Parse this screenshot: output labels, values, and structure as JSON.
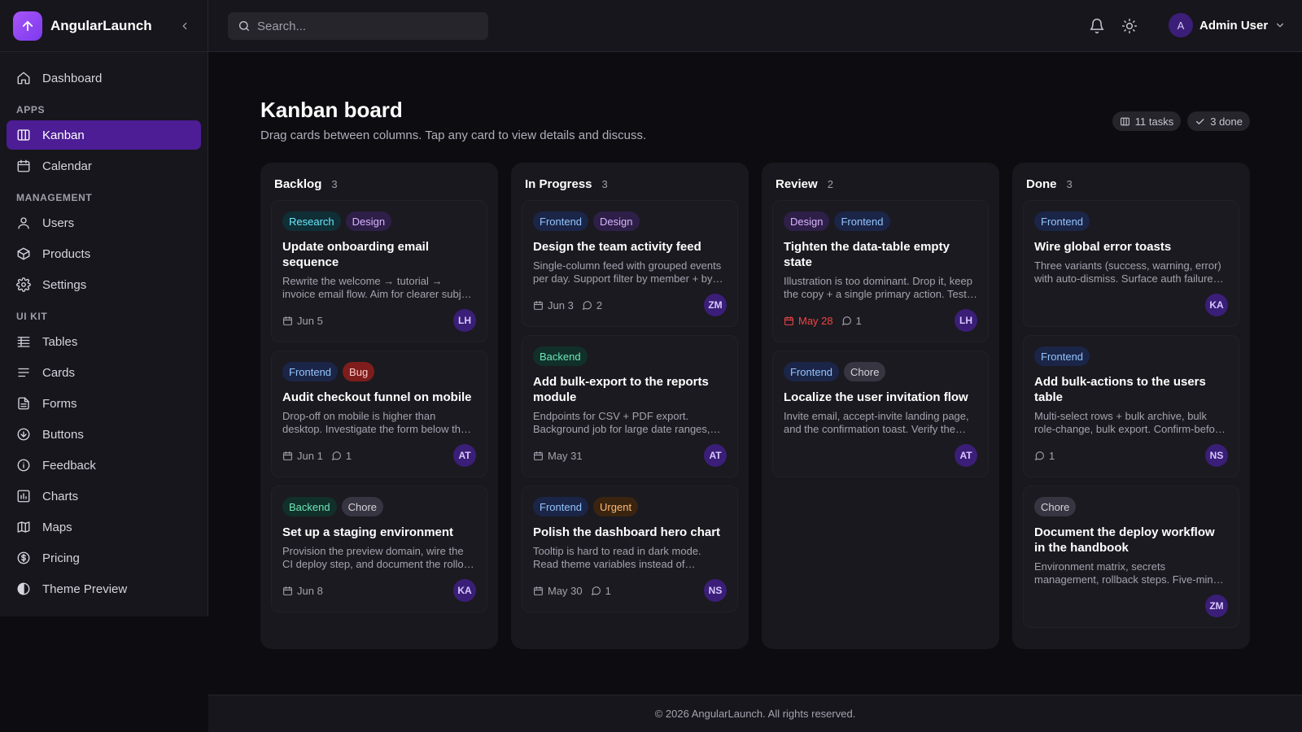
{
  "brand": {
    "name": "AngularLaunch"
  },
  "sidebar": {
    "top_items": [
      {
        "label": "Dashboard",
        "icon": "home-icon"
      }
    ],
    "sections": [
      {
        "title": "APPS",
        "items": [
          {
            "label": "Kanban",
            "icon": "kanban-icon",
            "active": true
          },
          {
            "label": "Calendar",
            "icon": "calendar-icon"
          }
        ]
      },
      {
        "title": "MANAGEMENT",
        "items": [
          {
            "label": "Users",
            "icon": "user-icon"
          },
          {
            "label": "Products",
            "icon": "box-icon"
          },
          {
            "label": "Settings",
            "icon": "gear-icon"
          }
        ]
      },
      {
        "title": "UI KIT",
        "items": [
          {
            "label": "Tables",
            "icon": "table-icon"
          },
          {
            "label": "Cards",
            "icon": "cards-icon"
          },
          {
            "label": "Forms",
            "icon": "forms-icon"
          },
          {
            "label": "Buttons",
            "icon": "buttons-icon"
          },
          {
            "label": "Feedback",
            "icon": "info-icon"
          },
          {
            "label": "Charts",
            "icon": "chart-icon"
          },
          {
            "label": "Maps",
            "icon": "map-icon"
          },
          {
            "label": "Pricing",
            "icon": "dollar-icon"
          },
          {
            "label": "Theme Preview",
            "icon": "theme-icon"
          }
        ]
      }
    ]
  },
  "search": {
    "placeholder": "Search..."
  },
  "user": {
    "initial": "A",
    "name": "Admin User"
  },
  "page": {
    "title": "Kanban board",
    "subtitle": "Drag cards between columns. Tap any card to view details and discuss.",
    "tasks_badge": "11 tasks",
    "done_badge": "3 done"
  },
  "tag_colors": {
    "Research": {
      "bg": "#0f2e36",
      "fg": "#67e8f9"
    },
    "Design": {
      "bg": "#2e1f48",
      "fg": "#d8b4fe"
    },
    "Frontend": {
      "bg": "#1b2547",
      "fg": "#93c5fd"
    },
    "Bug": {
      "bg": "#7f1d1d",
      "fg": "#fecaca"
    },
    "Backend": {
      "bg": "#11302a",
      "fg": "#6ee7b7"
    },
    "Chore": {
      "bg": "#363541",
      "fg": "#d4d4d8"
    },
    "Urgent": {
      "bg": "#3a2410",
      "fg": "#fdba74"
    }
  },
  "columns": [
    {
      "title": "Backlog",
      "count": "3",
      "cards": [
        {
          "tags": [
            "Research",
            "Design"
          ],
          "title": "Update onboarding email sequence",
          "desc": "Rewrite the welcome → tutorial → invoice email flow. Aim for clearer subject lines and a stronger CTA in the second email.",
          "date": "Jun 5",
          "comments": "",
          "assignee": "LH"
        },
        {
          "tags": [
            "Frontend",
            "Bug"
          ],
          "title": "Audit checkout funnel on mobile",
          "desc": "Drop-off on mobile is higher than desktop. Investigate the form below the fold and the payment step.",
          "date": "Jun 1",
          "comments": "1",
          "assignee": "AT"
        },
        {
          "tags": [
            "Backend",
            "Chore"
          ],
          "title": "Set up a staging environment",
          "desc": "Provision the preview domain, wire the CI deploy step, and document the rollout process for the team.",
          "date": "Jun 8",
          "comments": "",
          "assignee": "KA"
        }
      ]
    },
    {
      "title": "In Progress",
      "count": "3",
      "cards": [
        {
          "tags": [
            "Frontend",
            "Design"
          ],
          "title": "Design the team activity feed",
          "desc": "Single-column feed with grouped events per day. Support filter by member + by event type.",
          "date": "Jun 3",
          "comments": "2",
          "assignee": "ZM"
        },
        {
          "tags": [
            "Backend"
          ],
          "title": "Add bulk-export to the reports module",
          "desc": "Endpoints for CSV + PDF export. Background job for large date ranges, with email notification.",
          "date": "May 31",
          "comments": "",
          "assignee": "AT"
        },
        {
          "tags": [
            "Frontend",
            "Urgent"
          ],
          "title": "Polish the dashboard hero chart",
          "desc": "Tooltip is hard to read in dark mode. Read theme variables instead of hardcoded colors.",
          "date": "May 30",
          "comments": "1",
          "assignee": "NS"
        }
      ]
    },
    {
      "title": "Review",
      "count": "2",
      "cards": [
        {
          "tags": [
            "Design",
            "Frontend"
          ],
          "title": "Tighten the data-table empty state",
          "desc": "Illustration is too dominant. Drop it, keep the copy + a single primary action. Test with real data.",
          "date": "May 28",
          "overdue": true,
          "comments": "1",
          "assignee": "LH"
        },
        {
          "tags": [
            "Frontend",
            "Chore"
          ],
          "title": "Localize the user invitation flow",
          "desc": "Invite email, accept-invite landing page, and the confirmation toast. Verify the RTL layout.",
          "date": "",
          "comments": "",
          "assignee": "AT"
        }
      ]
    },
    {
      "title": "Done",
      "count": "3",
      "cards": [
        {
          "tags": [
            "Frontend"
          ],
          "title": "Wire global error toasts",
          "desc": "Three variants (success, warning, error) with auto-dismiss. Surface auth failures globally.",
          "date": "",
          "comments": "",
          "assignee": "KA"
        },
        {
          "tags": [
            "Frontend"
          ],
          "title": "Add bulk-actions to the users table",
          "desc": "Multi-select rows + bulk archive, bulk role-change, bulk export. Confirm-before-destructive actions.",
          "date": "",
          "comments": "1",
          "assignee": "NS"
        },
        {
          "tags": [
            "Chore"
          ],
          "title": "Document the deploy workflow in the handbook",
          "desc": "Environment matrix, secrets management, rollback steps. Five-minute read for new hires.",
          "date": "",
          "comments": "",
          "assignee": "ZM"
        }
      ]
    }
  ],
  "footer": {
    "text": "© 2026 AngularLaunch. All rights reserved."
  }
}
